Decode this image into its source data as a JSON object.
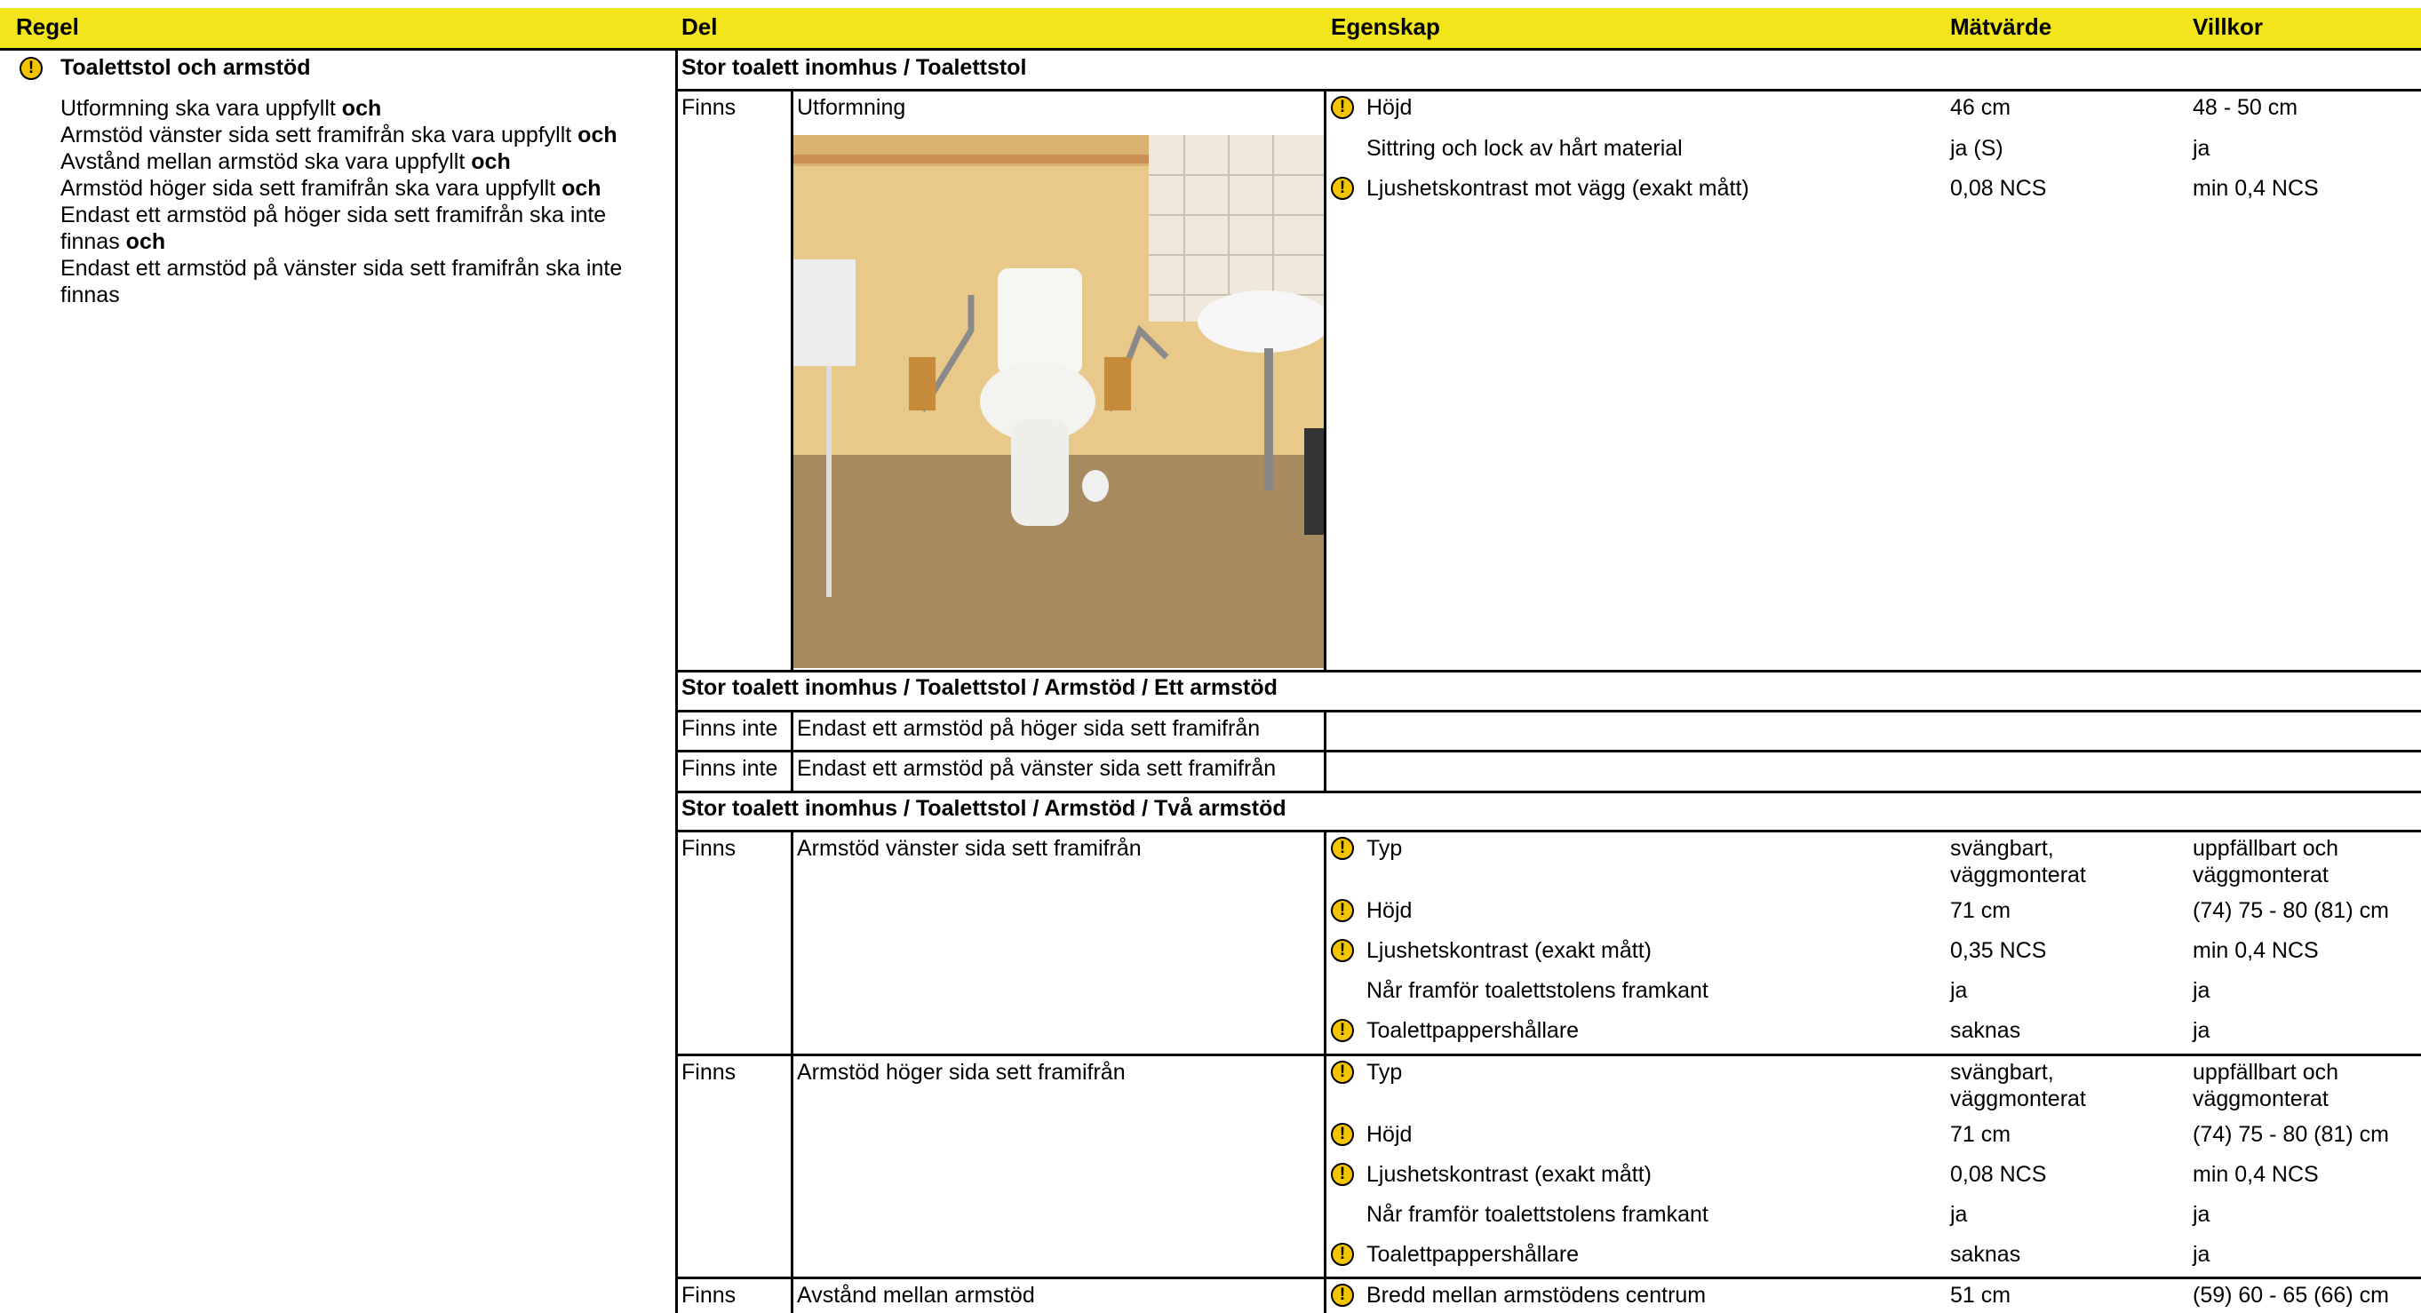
{
  "header": {
    "regel": "Regel",
    "del": "Del",
    "egenskap": "Egenskap",
    "matvarde": "Mätvärde",
    "villkor": "Villkor"
  },
  "rule": {
    "title": "Toalettstol och armstöd",
    "lines": [
      {
        "text": "Utformning ska vara uppfyllt ",
        "conj": "och"
      },
      {
        "text": "Armstöd vänster sida sett framifrån ska vara uppfyllt ",
        "conj": "och"
      },
      {
        "text": "Avstånd mellan armstöd ska vara uppfyllt ",
        "conj": "och"
      },
      {
        "text": "Armstöd höger sida sett framifrån ska vara uppfyllt ",
        "conj": "och"
      },
      {
        "text": "Endast ett armstöd på höger sida sett framifrån ska inte",
        "conj": ""
      },
      {
        "text": "finnas ",
        "conj": "och"
      },
      {
        "text": "Endast ett armstöd på vänster sida sett framifrån ska inte",
        "conj": ""
      },
      {
        "text": "finnas",
        "conj": ""
      }
    ]
  },
  "sections": [
    {
      "title": "Stor toalett inomhus / Toalettstol"
    },
    {
      "title": "Stor toalett inomhus / Toalettstol / Armstöd / Ett armstöd"
    },
    {
      "title": "Stor toalett inomhus / Toalettstol / Armstöd / Två armstöd"
    }
  ],
  "parts": {
    "utformning": {
      "status": "Finns",
      "name": "Utformning"
    },
    "ett_hoger": {
      "status": "Finns inte",
      "name": "Endast ett armstöd på höger sida sett framifrån"
    },
    "ett_vanster": {
      "status": "Finns inte",
      "name": "Endast ett armstöd på vänster sida sett framifrån"
    },
    "vanster": {
      "status": "Finns",
      "name": "Armstöd vänster sida sett framifrån"
    },
    "hoger": {
      "status": "Finns",
      "name": "Armstöd höger sida sett framifrån"
    },
    "avstand": {
      "status": "Finns",
      "name": "Avstånd mellan armstöd"
    }
  },
  "props": {
    "utformning": [
      {
        "warn": true,
        "name": "Höjd",
        "value": "46 cm",
        "cond": "48 - 50 cm"
      },
      {
        "warn": false,
        "name": "Sittring och lock av hårt material",
        "value": "ja (S)",
        "cond": "ja"
      },
      {
        "warn": true,
        "name": "Ljushetskontrast mot vägg (exakt mått)",
        "value": "0,08 NCS",
        "cond": "min 0,4 NCS"
      }
    ],
    "vanster": [
      {
        "warn": true,
        "name": "Typ",
        "value": "svängbart,",
        "value2": "väggmonterat",
        "cond": "uppfällbart och",
        "cond2": "väggmonterat"
      },
      {
        "warn": true,
        "name": "Höjd",
        "value": "71 cm",
        "cond": "(74) 75 - 80 (81) cm"
      },
      {
        "warn": true,
        "name": "Ljushetskontrast (exakt mått)",
        "value": "0,35 NCS",
        "cond": "min 0,4 NCS"
      },
      {
        "warn": false,
        "name": "Når framför toalettstolens framkant",
        "value": "ja",
        "cond": "ja"
      },
      {
        "warn": true,
        "name": "Toalettpappershållare",
        "value": "saknas",
        "cond": "ja"
      }
    ],
    "hoger": [
      {
        "warn": true,
        "name": "Typ",
        "value": "svängbart,",
        "value2": "väggmonterat",
        "cond": "uppfällbart och",
        "cond2": "väggmonterat"
      },
      {
        "warn": true,
        "name": "Höjd",
        "value": "71 cm",
        "cond": "(74) 75 - 80 (81) cm"
      },
      {
        "warn": true,
        "name": "Ljushetskontrast (exakt mått)",
        "value": "0,08 NCS",
        "cond": "min 0,4 NCS"
      },
      {
        "warn": false,
        "name": "Når framför toalettstolens framkant",
        "value": "ja",
        "cond": "ja"
      },
      {
        "warn": true,
        "name": "Toalettpappershållare",
        "value": "saknas",
        "cond": "ja"
      }
    ],
    "avstand": [
      {
        "warn": true,
        "name": "Bredd mellan armstödens centrum",
        "value": "51 cm",
        "cond": "(59) 60 - 65 (66) cm"
      }
    ]
  },
  "icons": {
    "warning": "warning-icon",
    "warning_color": "#f5c400",
    "header_color": "#f3e51b"
  }
}
